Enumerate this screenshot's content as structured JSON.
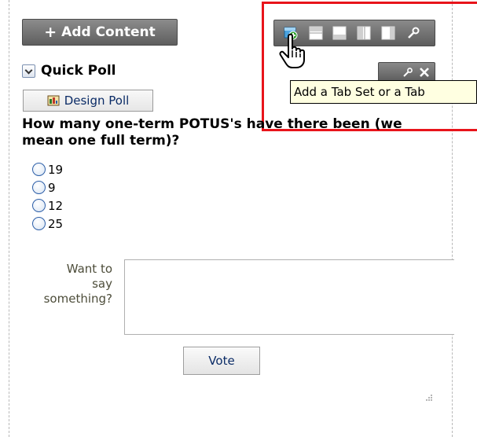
{
  "toolbar": {
    "add_content_label": "Add Content",
    "add_content_icon": "plus-icon",
    "tooltip": "Add a Tab Set or a Tab",
    "icons": [
      "add-tab-icon",
      "layout-top-icon",
      "layout-bottom-icon",
      "layout-two-column-icon",
      "layout-right-column-icon",
      "wrench-icon"
    ]
  },
  "portlet": {
    "title": "Quick Poll",
    "action_icons": [
      "wrench-icon",
      "close-icon"
    ],
    "design_poll_label": "Design Poll",
    "question": "How many one-term POTUS's have there been (we mean one full term)?",
    "options": [
      "19",
      "9",
      "12",
      "25"
    ],
    "comment_label_lines": [
      "Want to",
      "say",
      "something?"
    ],
    "comment_value": "",
    "vote_label": "Vote"
  },
  "colors": {
    "toolbar_bg": "#6e6e6e",
    "highlight_border": "#e8141b",
    "tooltip_bg": "#ffffe1",
    "link_text": "#0a2b66"
  }
}
